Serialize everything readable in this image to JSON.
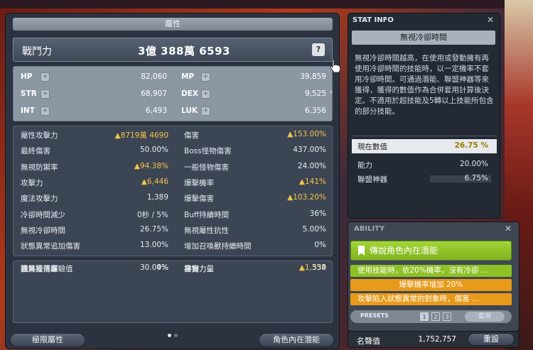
{
  "main": {
    "title": "屬性",
    "combat_label": "戰鬥力",
    "combat_value": "3億 388萬 6593",
    "help_label": "?",
    "base_stats": [
      {
        "name": "HP",
        "value": "82,060"
      },
      {
        "name": "MP",
        "value": "39,859"
      },
      {
        "name": "STR",
        "value": "68,907"
      },
      {
        "name": "DEX",
        "value": "9,525"
      },
      {
        "name": "INT",
        "value": "6,493"
      },
      {
        "name": "LUK",
        "value": "6,356"
      }
    ],
    "detail_stats": [
      {
        "name": "屬性攻擊力",
        "value": "▲8719萬 4690",
        "up": true
      },
      {
        "name": "傷害",
        "value": "▲153.00%",
        "up": true
      },
      {
        "name": "最終傷害",
        "value": "50.00%",
        "up": false
      },
      {
        "name": "Boss怪物傷害",
        "value": "437.00%",
        "up": false
      },
      {
        "name": "無視防禦率",
        "value": "▲94.38%",
        "up": true
      },
      {
        "name": "一般怪物傷害",
        "value": "24.00%",
        "up": false
      },
      {
        "name": "攻擊力",
        "value": "▲6,446",
        "up": true
      },
      {
        "name": "爆擊機率",
        "value": "▲141%",
        "up": true
      },
      {
        "name": "魔法攻擊力",
        "value": "1,389",
        "up": false
      },
      {
        "name": "爆擊傷害",
        "value": "▲103.20%",
        "up": true
      },
      {
        "name": "冷卻時間減少",
        "value": "0秒 / 5%",
        "up": false
      },
      {
        "name": "Buff持續時間",
        "value": "36%",
        "up": false
      },
      {
        "name": "無視冷卻時間",
        "value": "26.75%",
        "up": false
      },
      {
        "name": "無視屬性抗性",
        "value": "5.00%",
        "up": false
      },
      {
        "name": "狀態異常追加傷害",
        "value": "13.00%",
        "up": false
      },
      {
        "name": "增加召喚獸持續時間",
        "value": "0%",
        "up": false
      }
    ],
    "extra_stats": [
      {
        "name": "楓幣獲得量",
        "value": "4%",
        "up": false
      },
      {
        "name": "星力",
        "value": "334",
        "up": false
      },
      {
        "name": "道具掉落率",
        "value": "0%",
        "up": false
      },
      {
        "name": "神祕力量",
        "value": "▲1,355",
        "up": true
      },
      {
        "name": "額外獲得經驗值",
        "value": "30.00%",
        "up": false
      },
      {
        "name": "真實力量",
        "value": "530",
        "up": false
      }
    ],
    "hyper_button": "極限屬性",
    "inner_button": "角色內在潛能"
  },
  "info": {
    "header": "STAT INFO",
    "close": "✕",
    "name": "無視冷卻時間",
    "description": "無視冷卻時間越高，在使用或發動擁有再使用冷卻時間的技能時，以一定機率不套用冷卻時間。可通過潛能、聯盟神器等來獲得，獲得的數值作為合併套用計算後決定。不適用於超技能及5轉以上技能所包含的部分技能。",
    "current_label": "現在數值",
    "current_value": "26.75 %",
    "rows": [
      {
        "name": "能力",
        "value": "20.00%"
      },
      {
        "name": "聯盟神器",
        "value": "6.75%"
      }
    ]
  },
  "ability": {
    "header": "ABILITY",
    "close": "✕",
    "grade": "傳說角色內在潛能",
    "lines": [
      "使用技能時，依20%機率，沒有冷卻 ...",
      "爆擊機率增加 20%",
      "攻擊陷入狀態異常的對象時，傷害 ..."
    ],
    "presets_label": "PRESETS",
    "presets": [
      "1",
      "2",
      "3"
    ],
    "apply_label": "套用"
  },
  "honor": {
    "label": "名聲值",
    "value": "1,752,757",
    "reset_label": "重設"
  },
  "colors": {
    "legendary_green": "#8ec124",
    "unique_orange": "#e89a1a",
    "increase_gold": "#f3c44a"
  }
}
